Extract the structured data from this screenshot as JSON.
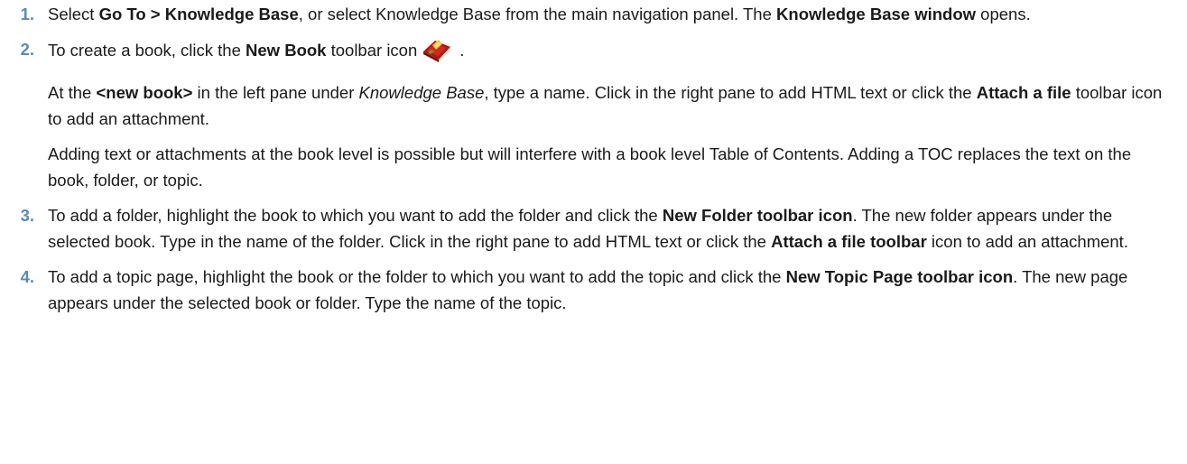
{
  "steps": [
    {
      "number": "1.",
      "paragraphs": [
        {
          "t1": "Select ",
          "b1": "Go To > Knowledge Base",
          "t2": ", or select Knowledge Base from the main navigation panel. The ",
          "b2": "Knowledge Base window",
          "t3": " opens."
        }
      ]
    },
    {
      "number": "2.",
      "paragraphs": [
        {
          "t1": "To create a book, click the ",
          "b1": "New Book",
          "t2": " toolbar icon",
          "t3": " ."
        },
        {
          "t1": "At the ",
          "b1": "<new book>",
          "t2": " in the left pane under ",
          "i1": "Knowledge Base",
          "t3": ", type a name. Click in the right pane to add HTML text or click the ",
          "b2": "Attach a file",
          "t4": " toolbar icon to add an attachment."
        },
        {
          "t1": "Adding text or attachments at the book level is possible but will interfere with a book level Table of Contents. Adding a TOC replaces the text on the book, folder, or topic."
        }
      ]
    },
    {
      "number": "3.",
      "paragraphs": [
        {
          "t1": "To add a folder, highlight the book to which you want to add the folder and click the ",
          "b1": "New Folder toolbar icon",
          "t2": ". The new folder appears under the selected book. Type in the name of the folder. Click in the right pane to add HTML text or click the ",
          "b2": "Attach a file toolbar",
          "t3": " icon to add an attachment."
        }
      ]
    },
    {
      "number": "4.",
      "paragraphs": [
        {
          "t1": "To add a topic page, highlight the book or the folder to which you want to add the topic and click the ",
          "b1": "New Topic Page toolbar icon",
          "t2": ". The new page appears under the selected book or folder. Type the name of the topic."
        }
      ]
    }
  ],
  "icons": {
    "new_book": "new-book-icon"
  }
}
